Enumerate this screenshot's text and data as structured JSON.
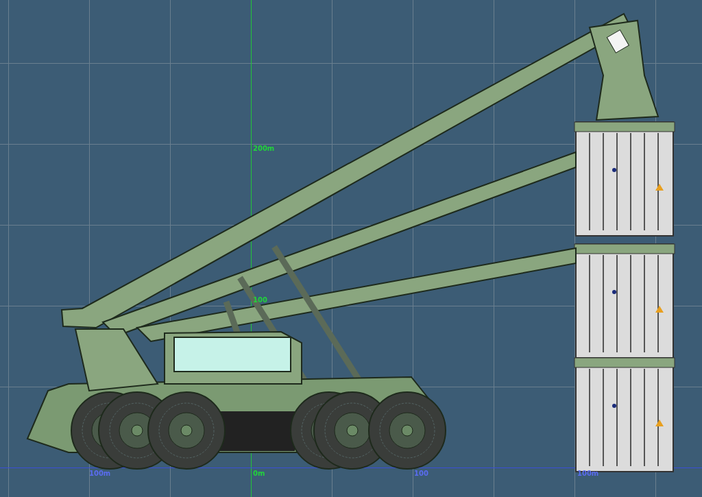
{
  "viewport": {
    "axis_labels": [
      {
        "text": "200m",
        "color": "#22d23c"
      },
      {
        "text": "100",
        "color": "#22d23c"
      },
      {
        "text": "100m",
        "color": "#5a6cf0"
      },
      {
        "text": "0m",
        "color": "#22d23c"
      },
      {
        "text": "100",
        "color": "#5a6cf0"
      },
      {
        "text": "100m",
        "color": "#5a6cf0"
      }
    ]
  }
}
